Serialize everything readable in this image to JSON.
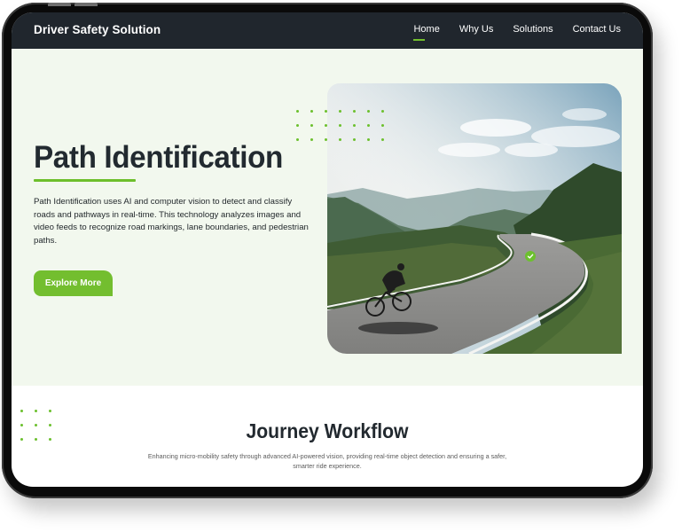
{
  "nav": {
    "brand": "Driver Safety Solution",
    "items": [
      {
        "label": "Home",
        "active": true
      },
      {
        "label": "Why Us",
        "active": false
      },
      {
        "label": "Solutions",
        "active": false
      },
      {
        "label": "Contact Us",
        "active": false
      }
    ]
  },
  "hero": {
    "title": "Path Identification",
    "description": "Path Identification uses AI and computer vision to detect and classify roads and pathways in real-time. This technology analyzes images and video feeds to recognize road markings, lane boundaries, and pedestrian paths.",
    "cta_label": "Explore More",
    "image_alt": "Cyclist riding on a winding mountain road",
    "icons": {
      "check": "check-circle-icon"
    }
  },
  "section2": {
    "title": "Journey Workflow",
    "description": "Enhancing micro-mobility safety through advanced AI-powered vision, providing real-time object detection and ensuring a safer, smarter ride experience."
  },
  "colors": {
    "accent": "#72bf2d",
    "nav_bg": "#20262d",
    "hero_bg": "#f2f8ee",
    "heading": "#222a30"
  }
}
